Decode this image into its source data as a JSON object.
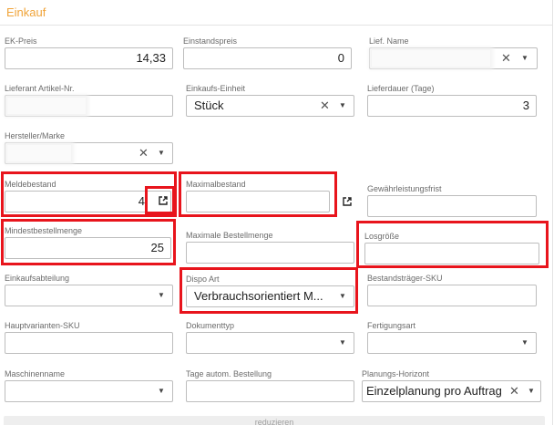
{
  "section": {
    "title": "Einkauf"
  },
  "fields": {
    "ek_preis": {
      "label": "EK-Preis",
      "value": "14,33"
    },
    "einstandspreis": {
      "label": "Einstandspreis",
      "value": "0"
    },
    "lief_name": {
      "label": "Lief. Name",
      "value": ""
    },
    "lieferant_artikel_nr": {
      "label": "Lieferant Artikel-Nr.",
      "value": ""
    },
    "einkaufs_einheit": {
      "label": "Einkaufs-Einheit",
      "value": "Stück"
    },
    "lieferdauer": {
      "label": "Lieferdauer (Tage)",
      "value": "3"
    },
    "hersteller_marke": {
      "label": "Hersteller/Marke",
      "value": ""
    },
    "meldebestand": {
      "label": "Meldebestand",
      "value": "4"
    },
    "maximalbestand": {
      "label": "Maximalbestand",
      "value": ""
    },
    "gewaehrleistungsfrist": {
      "label": "Gewährleistungsfrist",
      "value": ""
    },
    "mindestbestellmenge": {
      "label": "Mindestbestellmenge",
      "value": "25"
    },
    "maximale_bestellmenge": {
      "label": "Maximale Bestellmenge",
      "value": ""
    },
    "losgroesse": {
      "label": "Losgröße",
      "value": ""
    },
    "einkaufsabteilung": {
      "label": "Einkaufsabteilung",
      "value": ""
    },
    "dispo_art": {
      "label": "Dispo Art",
      "value": "Verbrauchsorientiert M..."
    },
    "bestandstraeger_sku": {
      "label": "Bestandsträger-SKU",
      "value": ""
    },
    "hauptvarianten_sku": {
      "label": "Hauptvarianten-SKU",
      "value": ""
    },
    "dokumenttyp": {
      "label": "Dokumenttyp",
      "value": ""
    },
    "fertigungsart": {
      "label": "Fertigungsart",
      "value": ""
    },
    "maschinenname": {
      "label": "Maschinenname",
      "value": ""
    },
    "tage_autom_bestellung": {
      "label": "Tage autom. Bestellung",
      "value": ""
    },
    "planungs_horizont": {
      "label": "Planungs-Horizont",
      "value": "Einzelplanung pro Auftrag"
    }
  },
  "icons": {
    "clear": "close-icon",
    "dropdown": "caret-down-icon",
    "external": "open-external-icon"
  },
  "footer": {
    "label": "reduzieren"
  },
  "colors": {
    "accent": "#f0a43a",
    "highlight": "#e8141c"
  }
}
